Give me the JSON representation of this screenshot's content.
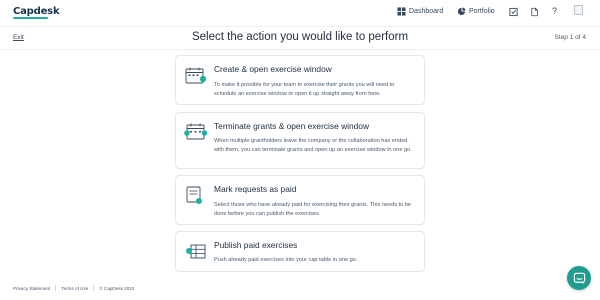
{
  "brand": {
    "logo_text": "Capdesk",
    "accent": "#1fb0a3"
  },
  "nav": {
    "dashboard_label": "Dashboard",
    "portfolio_label": "Portfolio",
    "icons": [
      "tasks-icon",
      "document-icon",
      "help-icon",
      "avatar-image"
    ],
    "help_symbol": "?"
  },
  "header": {
    "exit_label": "Exit",
    "title": "Select the action you would like to perform",
    "step": "Step 1 of 4"
  },
  "actions": [
    {
      "title": "Create & open exercise window",
      "description": "To make it possible for your team to exercise their grants you will need to schedule an exercise window or open it up straight away from here.",
      "icon": "calendar-plus-icon"
    },
    {
      "title": "Terminate grants & open exercise window",
      "description": "When multiple grantholders leave the company or the collaboration has ended with them, you can terminate grants and open up an exercise window in one go.",
      "icon": "calendar-terminate-icon"
    },
    {
      "title": "Mark requests as paid",
      "description": "Select those who have already paid for exercising their grants. This needs to be done before you can publish the exercises.",
      "icon": "paid-request-icon"
    },
    {
      "title": "Publish paid exercises",
      "description": "Push already paid exercises into your cap table in one go.",
      "icon": "cap-table-icon"
    }
  ],
  "footer": {
    "privacy": "Privacy Statement",
    "terms": "Terms of Use",
    "copyright": "© CapDesk 2022"
  },
  "chat": {
    "icon": "chat-icon",
    "color": "#1f9e8f"
  }
}
